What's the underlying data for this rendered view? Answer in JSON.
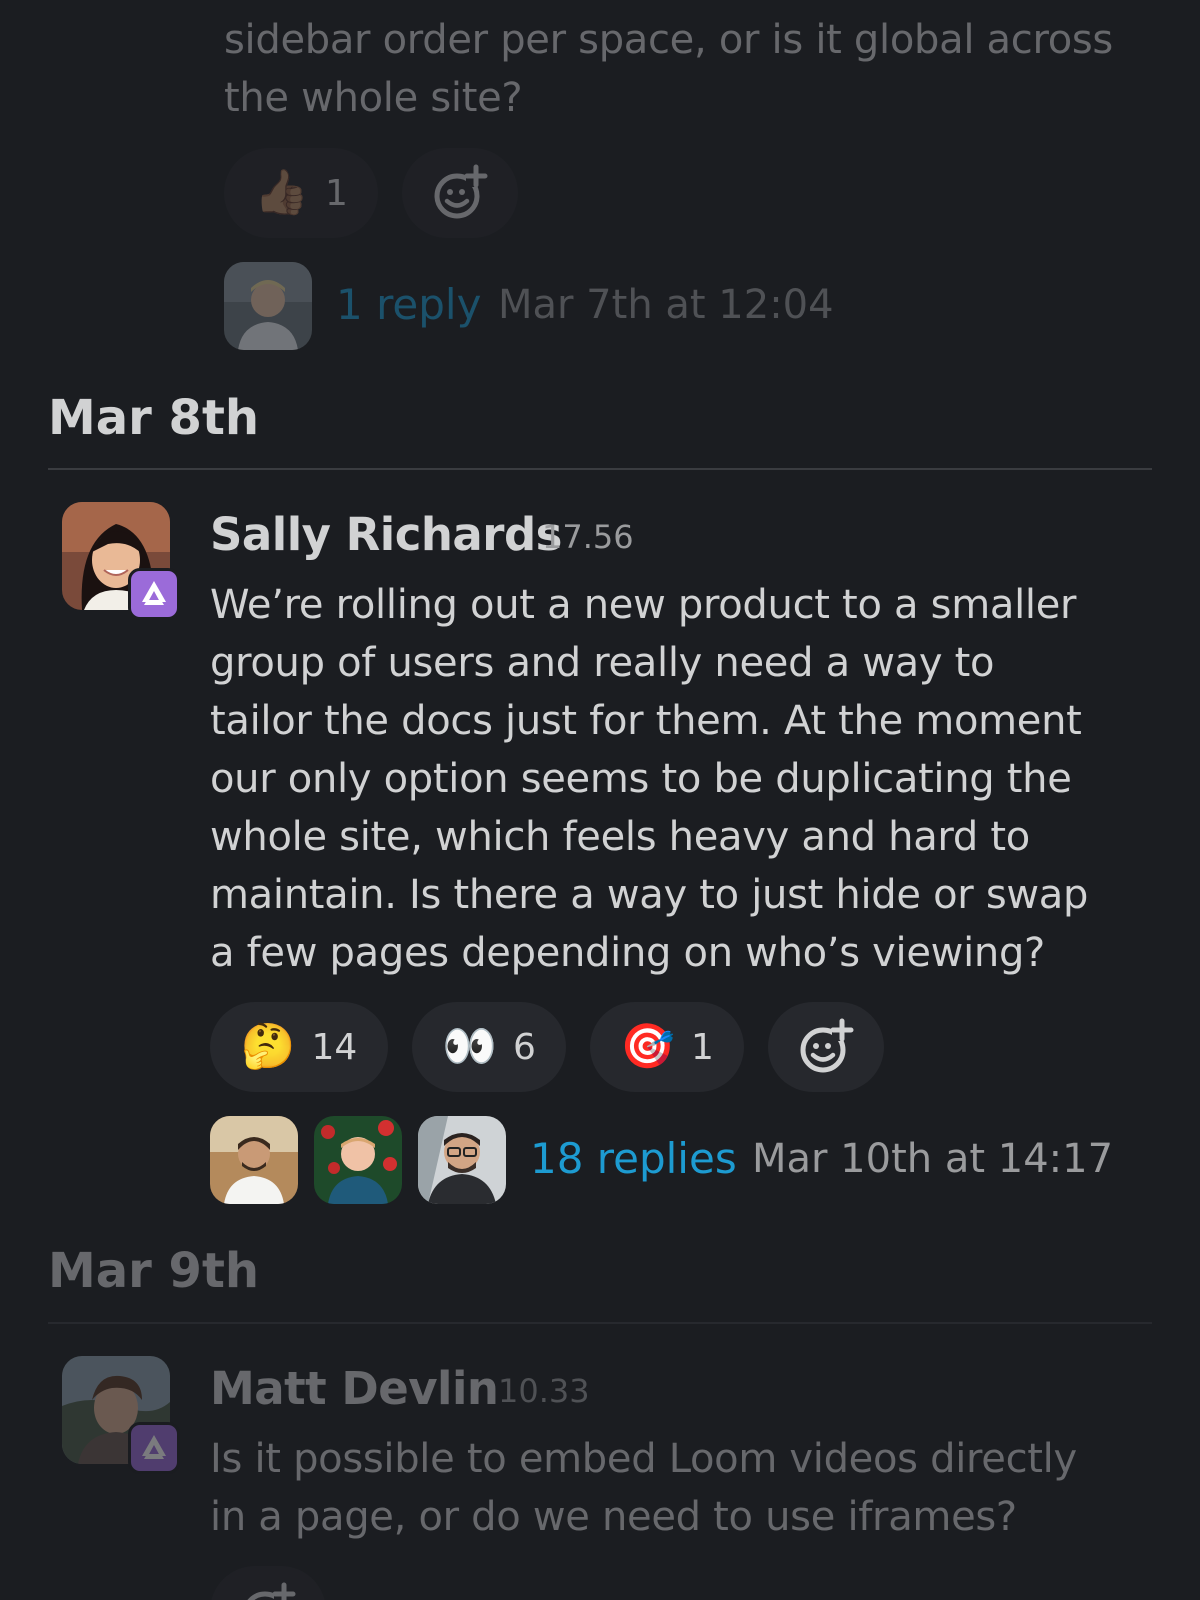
{
  "prev_message": {
    "text_lines": [
      "sidebar order per space, or is it global across",
      "the whole site?"
    ],
    "reactions": [
      {
        "emoji": "👍🏽",
        "count": "1"
      }
    ],
    "replies": {
      "label": "1 reply",
      "time": "Mar 7th at 12:04"
    }
  },
  "day1": {
    "date": "Mar 8th",
    "author": "Sally Richards",
    "time": "17.56",
    "text_lines": [
      "We’re rolling out a new product to a smaller",
      "group of users and really need a way to",
      "tailor the docs just for them. At the moment",
      "our only option seems to be duplicating the",
      "whole site, which feels heavy and hard to",
      "maintain. Is there a way to just hide or swap",
      "a few pages depending on who’s viewing?"
    ],
    "reactions": [
      {
        "emoji": "🤔",
        "count": "14"
      },
      {
        "emoji": "👀",
        "count": "6"
      },
      {
        "emoji": "🎯",
        "count": "1"
      }
    ],
    "replies": {
      "label": "18 replies",
      "time": "Mar 10th at 14:17"
    }
  },
  "day2": {
    "date": "Mar 9th",
    "author": "Matt Devlin",
    "time": "10.33",
    "text_lines": [
      "Is it possible to embed Loom videos directly",
      "in a page, or do we need to use iframes?"
    ]
  },
  "icons": {
    "add_reaction": "add-reaction-icon",
    "app_badge": "app-badge-icon"
  },
  "colors": {
    "background": "#1b1d21",
    "link": "#1d9bd1",
    "badge": "#9b6bd9",
    "reaction_bg": "#26282d"
  }
}
